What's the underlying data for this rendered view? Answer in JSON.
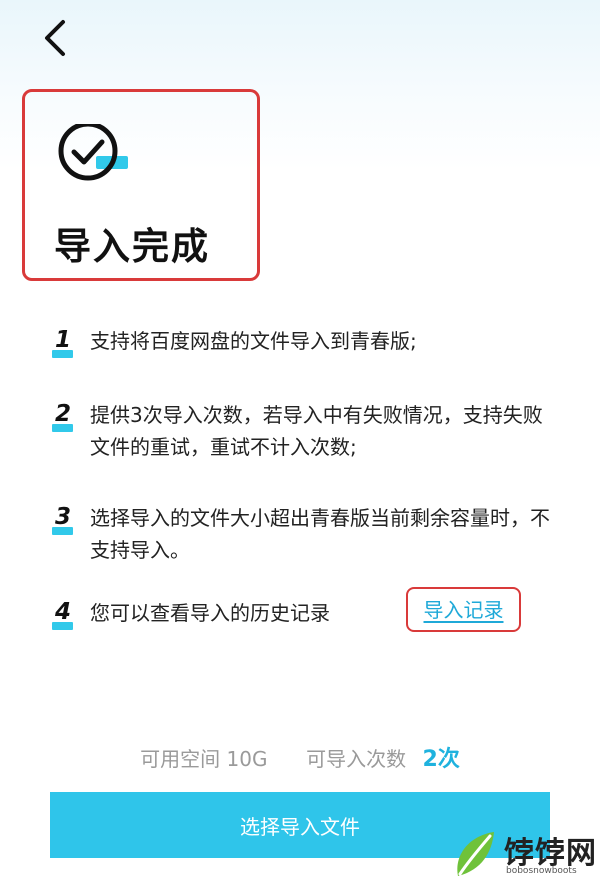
{
  "header": {
    "back_icon": "chevron-left-icon"
  },
  "hero": {
    "status_icon": "check-circle-icon",
    "title": "导入完成",
    "accent_color": "#31c9ea",
    "highlight_color": "#d93a3a"
  },
  "instructions": [
    {
      "number": "1",
      "text": "支持将百度网盘的文件导入到青春版;"
    },
    {
      "number": "2",
      "text": "提供3次导入次数，若导入中有失败情况，支持失败文件的重试，重试不计入次数;"
    },
    {
      "number": "3",
      "text": "选择导入的文件大小超出青春版当前剩余容量时，不支持导入。"
    },
    {
      "number": "4",
      "text": "您可以查看导入的历史记录",
      "link_label": "导入记录"
    }
  ],
  "quota": {
    "space_label": "可用空间",
    "space_value": "10G",
    "imports_label": "可导入次数",
    "imports_value": "2次"
  },
  "primary_button": {
    "label": "选择导入文件",
    "color": "#2fc5ea"
  },
  "watermark": {
    "brand": "饽饽网",
    "domain": "bobosnowboots"
  }
}
